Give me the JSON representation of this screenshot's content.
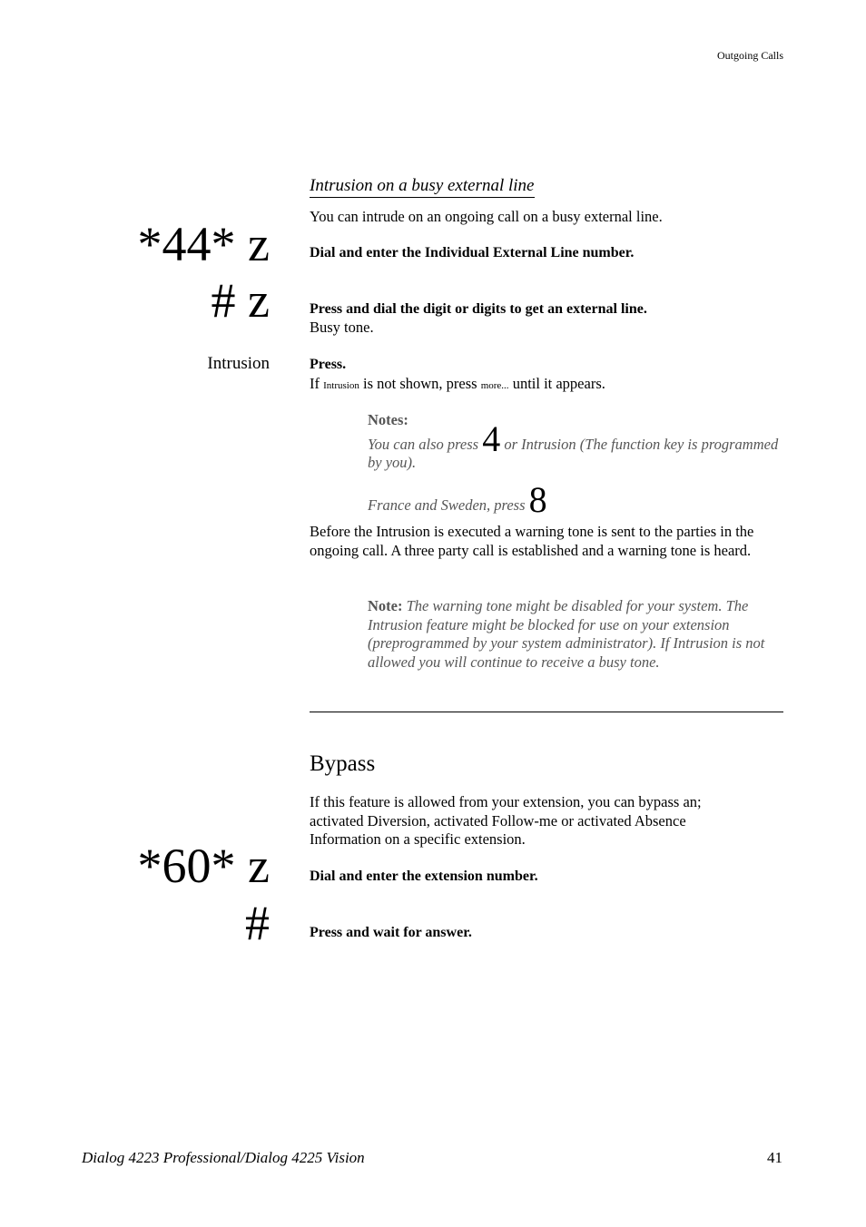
{
  "header": {
    "chapter": "Outgoing Calls"
  },
  "intrusion": {
    "title": "Intrusion on a busy external line",
    "intro": "You can intrude on an ongoing call on a busy external line.",
    "steps": [
      {
        "key": "*44* z",
        "instruction": "Dial and enter the Individual External Line number."
      },
      {
        "key": "# z",
        "instruction": "Press and dial the digit or digits to get an external line.",
        "detail": "Busy tone."
      },
      {
        "key": "Intrusion",
        "instruction": "Press.",
        "detail_prefix": "If",
        "detail_softkey": "Intrusion",
        "detail_mid": "is not shown, press",
        "detail_more": "more...",
        "detail_suffix": "until it appears."
      }
    ],
    "notes": {
      "label": "Notes:",
      "line1_prefix": "You can also press",
      "line1_key": "4",
      "line1_suffix": "or Intrusion (The function key is programmed by you).",
      "line2_prefix": "France and Sweden, press",
      "line2_key": "8"
    },
    "paragraph": "Before the Intrusion is executed a warning tone is sent to the parties in the ongoing call. A three party call is established and a warning tone is heard.",
    "note2": {
      "label": "Note:",
      "text": "The warning tone might be disabled for your system. The Intrusion feature might be blocked for use on your extension (preprogrammed by your system administrator). If Intrusion is not allowed you will continue to receive a busy tone."
    }
  },
  "bypass": {
    "title": "Bypass",
    "intro": "If this feature is allowed from your extension, you can bypass an; activated Diversion, activated Follow-me or activated Absence Information on a specific extension.",
    "steps": [
      {
        "key": "*60* z",
        "instruction": "Dial and enter the extension number."
      },
      {
        "key": "#",
        "instruction": "Press and wait for answer."
      }
    ]
  },
  "footer": {
    "product": "Dialog 4223 Professional/Dialog 4225 Vision",
    "page": "41"
  }
}
